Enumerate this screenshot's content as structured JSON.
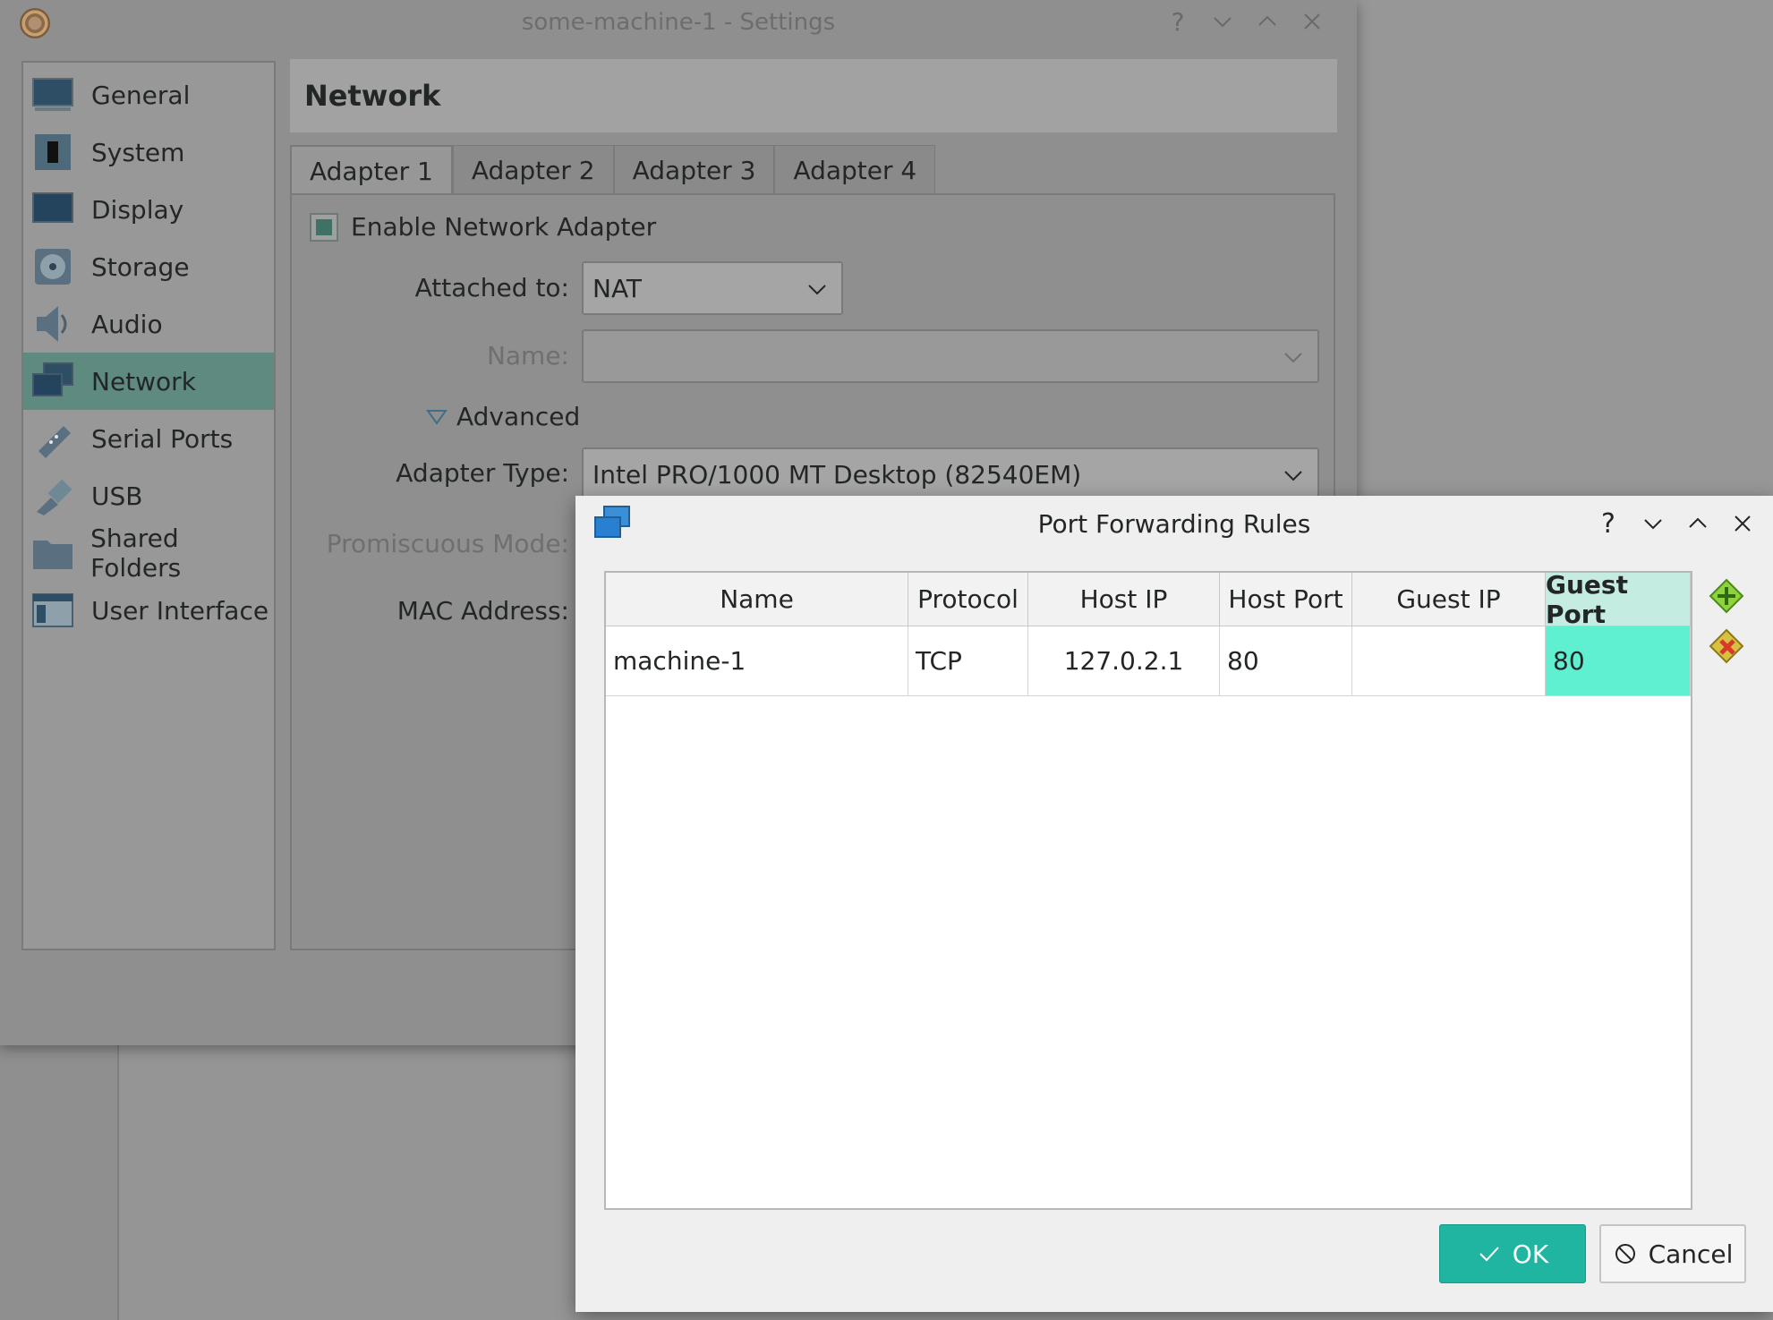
{
  "settings_window": {
    "title": "some-machine-1 - Settings",
    "controls": [
      "help",
      "minimize",
      "maximize",
      "close"
    ]
  },
  "sidebar": {
    "items": [
      {
        "label": "General",
        "icon": "monitor-icon"
      },
      {
        "label": "System",
        "icon": "chip-icon"
      },
      {
        "label": "Display",
        "icon": "display-icon"
      },
      {
        "label": "Storage",
        "icon": "disk-icon"
      },
      {
        "label": "Audio",
        "icon": "speaker-icon"
      },
      {
        "label": "Network",
        "icon": "network-icon",
        "active": true
      },
      {
        "label": "Serial Ports",
        "icon": "serial-port-icon"
      },
      {
        "label": "USB",
        "icon": "usb-icon"
      },
      {
        "label": "Shared Folders",
        "icon": "folder-icon"
      },
      {
        "label": "User Interface",
        "icon": "window-icon"
      }
    ]
  },
  "network": {
    "heading": "Network",
    "tabs": [
      "Adapter 1",
      "Adapter 2",
      "Adapter 3",
      "Adapter 4"
    ],
    "enable_label": "Enable Network Adapter",
    "enable_checked": true,
    "attached_label": "Attached to:",
    "attached_value": "NAT",
    "name_label": "Name:",
    "name_value": "",
    "advanced_label": "Advanced",
    "adapter_type_label": "Adapter Type:",
    "adapter_type_value": "Intel PRO/1000 MT Desktop (82540EM)",
    "promiscuous_label": "Promiscuous Mode:",
    "mac_label": "MAC Address:"
  },
  "dialog": {
    "title": "Port Forwarding Rules",
    "columns": [
      "Name",
      "Protocol",
      "Host IP",
      "Host Port",
      "Guest IP",
      "Guest Port"
    ],
    "selected_column": "Guest Port",
    "rows": [
      {
        "name": "machine-1",
        "protocol": "TCP",
        "host_ip": "127.0.2.1",
        "host_port": "80",
        "guest_ip": "",
        "guest_port": "80"
      }
    ],
    "ok_label": "OK",
    "cancel_label": "Cancel",
    "colors": {
      "accent": "#1fb5a0",
      "selected_cell": "#5ff0d2",
      "selected_header": "#c4ece0"
    }
  }
}
